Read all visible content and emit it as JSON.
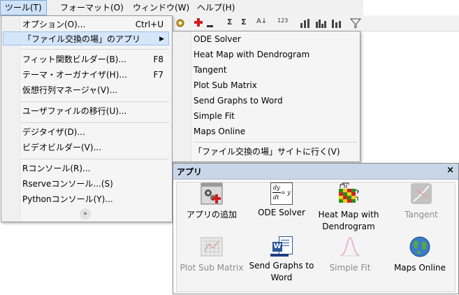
{
  "menubar": {
    "items": [
      "ツール(T)",
      "フォーマット(O)",
      "ウィンドウ(W)",
      "ヘルプ(H)"
    ]
  },
  "toolbar": {
    "icons": [
      "add-icon",
      "sum-icon",
      "sigma-icon",
      "sort-icon",
      "number-format-icon",
      "bar-chart-icon",
      "histogram-icon",
      "column-chart-icon",
      "filter-icon"
    ],
    "labels": [
      "Σ",
      "Σ",
      "A↓",
      "123"
    ]
  },
  "tools_menu": {
    "items": [
      {
        "label": "オプション(O)...",
        "shortcut": "Ctrl+U"
      },
      {
        "label": "「ファイル交換の場」のアプリ",
        "shortcut": ""
      },
      {
        "label": "フィット関数ビルダー(B)...",
        "shortcut": "F8"
      },
      {
        "label": "テーマ・オーガナイザ(H)...",
        "shortcut": "F7"
      },
      {
        "label": "仮想行列マネージャ(V)...",
        "shortcut": ""
      },
      {
        "label": "ユーザファイルの移行(U)...",
        "shortcut": ""
      },
      {
        "label": "デジタイザ(D)...",
        "shortcut": ""
      },
      {
        "label": "ビデオビルダー(V)...",
        "shortcut": ""
      },
      {
        "label": "Rコンソール(R)...",
        "shortcut": ""
      },
      {
        "label": "Rserveコンソール...(S)",
        "shortcut": ""
      },
      {
        "label": "Pythonコンソール(Y)...",
        "shortcut": ""
      }
    ],
    "more_icon": "chevron-double-down-icon"
  },
  "apps_submenu": {
    "items": [
      "ODE Solver",
      "Heat Map with Dendrogram",
      "Tangent",
      "Plot Sub Matrix",
      "Send Graphs to Word",
      "Simple Fit",
      "Maps Online"
    ],
    "visit_link": "「ファイル交換の場」サイトに行く(V)"
  },
  "apps_panel": {
    "title": "アプリ",
    "close": "×",
    "apps": [
      {
        "label": "アプリの追加",
        "icon": "add-app-icon",
        "enabled": true
      },
      {
        "label": "ODE Solver",
        "icon": "ode-formula-icon",
        "enabled": true
      },
      {
        "label": "Heat Map with Dendrogram",
        "icon": "heatmap-icon",
        "enabled": true
      },
      {
        "label": "Tangent",
        "icon": "tangent-icon",
        "enabled": false
      },
      {
        "label": "Plot Sub Matrix",
        "icon": "sub-matrix-icon",
        "enabled": false
      },
      {
        "label": "Send Graphs to Word",
        "icon": "word-icon",
        "enabled": true
      },
      {
        "label": "Simple Fit",
        "icon": "peak-fit-icon",
        "enabled": false
      },
      {
        "label": "Maps Online",
        "icon": "globe-icon",
        "enabled": true
      }
    ],
    "ode_formula": {
      "num": "dy",
      "den": "dt",
      "rhs": "= y"
    },
    "word_glyph": "W"
  }
}
